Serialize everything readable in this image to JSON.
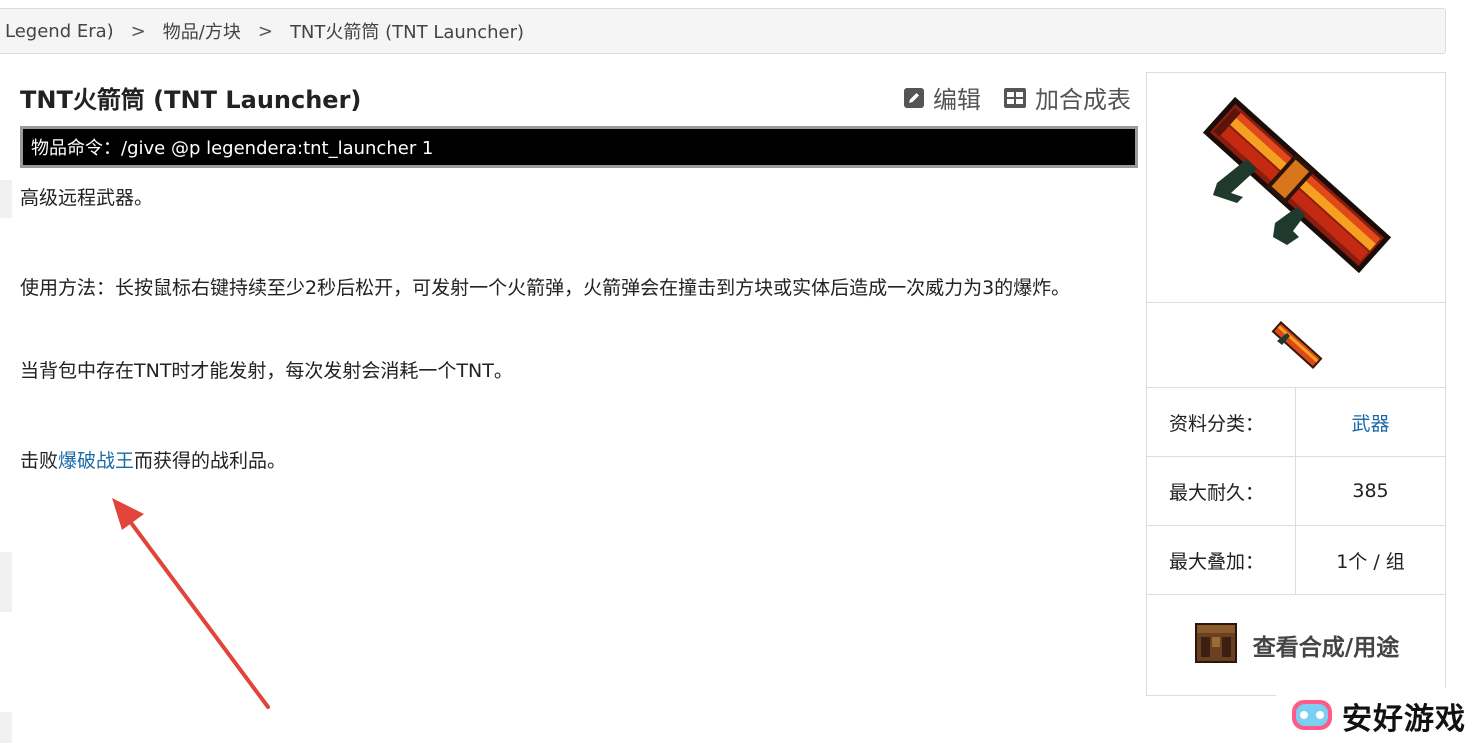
{
  "breadcrumb": {
    "items": [
      "Legend Era)",
      "物品/方块",
      "TNT火箭筒 (TNT Launcher)"
    ],
    "separator": ">"
  },
  "page": {
    "title": "TNT火箭筒 (TNT Launcher)",
    "actions": {
      "edit": "编辑",
      "add_recipe": "加合成表"
    },
    "command": "物品命令：/give @p legendera:tnt_launcher 1",
    "paragraphs": {
      "p1": "高级远程武器。",
      "p2": "使用方法：长按鼠标右键持续至少2秒后松开，可发射一个火箭弹，火箭弹会在撞击到方块或实体后造成一次威力为3的爆炸。",
      "p3": "当背包中存在TNT时才能发射，每次发射会消耗一个TNT。",
      "p4_pre": "击败",
      "p4_link": "爆破战王",
      "p4_post": "而获得的战利品。"
    }
  },
  "infobox": {
    "rows": [
      {
        "key": "资料分类：",
        "value": "武器",
        "is_link": true
      },
      {
        "key": "最大耐久：",
        "value": "385",
        "is_link": false
      },
      {
        "key": "最大叠加：",
        "value": "1个 / 组",
        "is_link": false
      }
    ],
    "recipe_label": "查看合成/用途"
  },
  "watermark": {
    "text": "安好游戏"
  },
  "colors": {
    "link": "#1a6aa6",
    "command_bg": "#000000",
    "arrow": "#e0443a"
  },
  "icons": [
    "edit-icon",
    "table-icon",
    "tnt-launcher-icon",
    "crafting-table-icon",
    "logo-icon"
  ]
}
